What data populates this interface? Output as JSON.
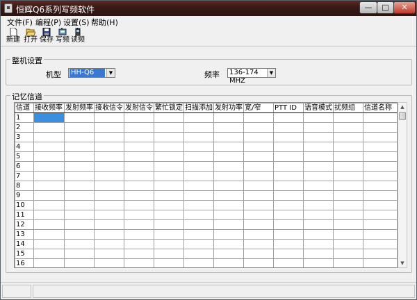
{
  "window": {
    "title": "恒辉Q6系列写频软件"
  },
  "title_buttons": {
    "minimize": "—",
    "maximize": "□",
    "close": "✕"
  },
  "menu": [
    "文件(F)",
    "编程(P)",
    "设置(S)",
    "帮助(H)"
  ],
  "toolbar": [
    {
      "label": "新建",
      "icon": "new-file-icon"
    },
    {
      "label": "打开",
      "icon": "open-folder-icon"
    },
    {
      "label": "保存",
      "icon": "save-icon"
    },
    {
      "label": "写频",
      "icon": "write-frequency-icon"
    },
    {
      "label": "读频",
      "icon": "read-frequency-icon"
    }
  ],
  "machine_settings": {
    "group_label": "整机设置",
    "model_label": "机型",
    "model_value": "HH-Q6",
    "freq_label": "频率",
    "freq_value": "136-174 MHZ"
  },
  "memory_channels": {
    "group_label": "记忆信道",
    "columns": [
      "信道",
      "接收频率",
      "发射频率",
      "接收信令",
      "发射信令",
      "繁忙锁定",
      "扫描添加",
      "发射功率",
      "宽/窄",
      "PTT ID",
      "语音模式",
      "扰频组",
      "信道名称"
    ],
    "rows": [
      "1",
      "2",
      "3",
      "4",
      "5",
      "6",
      "7",
      "8",
      "9",
      "10",
      "11",
      "12",
      "13",
      "14",
      "15",
      "16"
    ]
  },
  "scrollbar": {
    "up": "▲",
    "down": "▼"
  },
  "colors": {
    "titlebar": "#3b1a16",
    "selection": "#3a8fe0"
  }
}
